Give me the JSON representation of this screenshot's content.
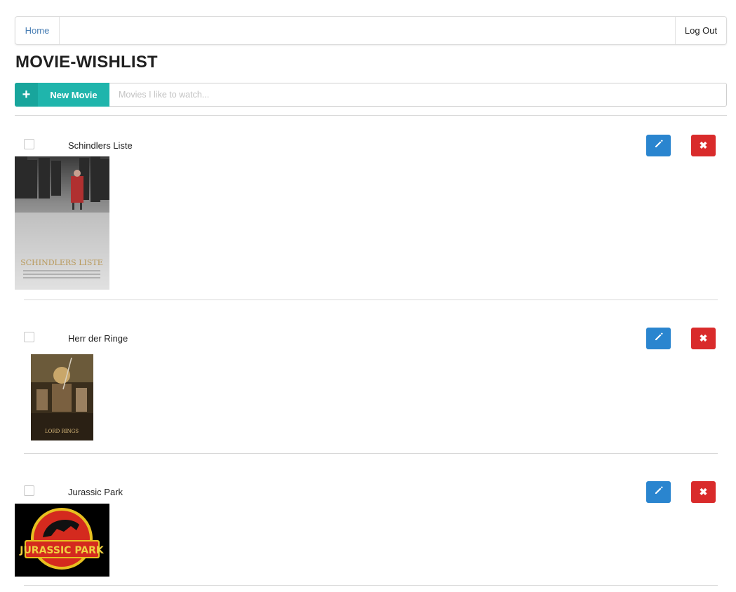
{
  "nav": {
    "home_label": "Home",
    "logout_label": "Log Out"
  },
  "page": {
    "title": "MOVIE-WISHLIST"
  },
  "new_movie": {
    "button_label": "New Movie",
    "plus_icon": "+",
    "placeholder": "Movies I like to watch..."
  },
  "colors": {
    "accent": "#1fb5ac",
    "edit": "#2a85cf",
    "delete": "#d92b2b",
    "link": "#4a7fb5"
  },
  "movies": [
    {
      "title": "Schindlers Liste",
      "poster_text": "SCHINDLERS LISTE",
      "checked": false
    },
    {
      "title": "Herr der Ringe",
      "poster_text": "LORD RINGS",
      "checked": false
    },
    {
      "title": "Jurassic Park",
      "poster_text": "JURASSIC PARK",
      "checked": false
    }
  ],
  "icons": {
    "edit": "pencil-icon",
    "delete": "close-icon",
    "delete_glyph": "✖"
  }
}
